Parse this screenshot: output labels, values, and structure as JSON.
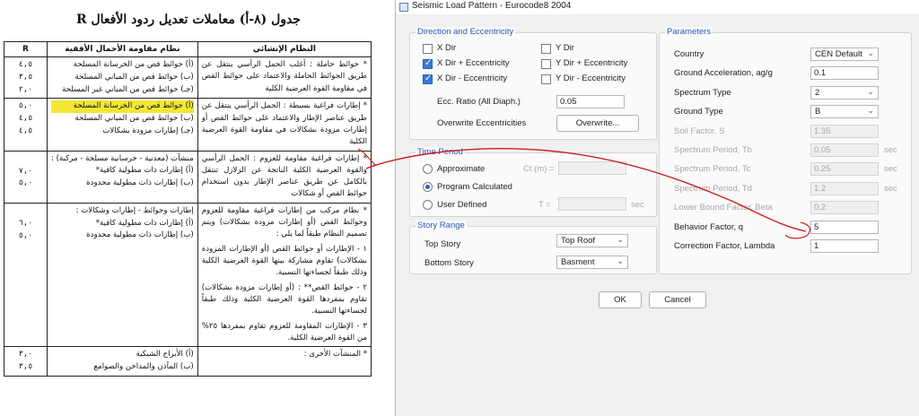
{
  "doc": {
    "title": "جدول (٨-أ) معاملات تعديل ردود الأفعال  R",
    "headers": {
      "r": "R",
      "resist": "نظام مقاومة الأحمال الأفقية",
      "structural": "النظام الإنشائي"
    },
    "rows": [
      {
        "r": [
          "٤,٥",
          "٣,٥",
          "٢,٠"
        ],
        "resist": [
          "(أ) حوائط قص من الخرسانة المسلحة",
          "(ب) حوائط قص من المباني المسلحة",
          "(جـ) حوائط قص من المباني غير المسلحة"
        ],
        "structural": "* حوائط حاملة : أغلب الحمل الرأسي ينتقل عن طريق الحوائط الحاملة والاعتماد على حوائط القص في مقاومة القوة العرضية الكلية"
      },
      {
        "r": [
          "٥,٠",
          "٤,٥",
          "٤,٥"
        ],
        "resist": [
          "(أ) حوائط قص من الخرسانة المسلحة",
          "(ب) حوائط قص من المباني المسلحة",
          "(جـ) إطارات مزودة بشكالات"
        ],
        "structural": "* إطارات فراغية بسيطة : الحمل الرأسي ينتقل عن طريق عناصر الإطار والاعتماد على حوائط القص أو إطارات مزودة بشكالات في مقاومة القوة العرضية الكلية"
      },
      {
        "r": [
          "٧,٠",
          "٥,٠"
        ],
        "resist": [
          "منشآت (معدنية - خرسانية مسلحة - مركبة) :",
          "(أ) إطارات ذات مطولية كافية*",
          "(ب) إطارات ذات مطولية محدودة"
        ],
        "structural": "* إطارات فراغية مقاومة للعزوم : الحمل الرأسي والقوة العرضية الكلية الناتجة عن الزلازل تنتقل بالكامل عن طريق عناصر الإطار بدون استخدام حوائط القص أو شكالات"
      },
      {
        "r": [
          "٦,٠",
          "٥,٠"
        ],
        "resist": [
          "إطارات وحوائط - إطارات وشكالات :",
          "(أ) إطارات ذات مطولية كافية*",
          "(ب) إطارات ذات مطولية محدودة"
        ],
        "structural": "* نظام مركب من إطارات فراغية مقاومة للعزوم وحوائط القص (أو إطارات مزودة بشكالات) ويتم تصميم النظام طبقاً لما يلي :",
        "structural_items": [
          "١ - الإطارات أو حوائط القص (أو الإطارات المزودة بشكالات) تقاوم مشاركة بينها القوة العرضية الكلية وذلك طبقاً لجساءتها النسبية.",
          "٢ - حوائط القص** : (أو إطارات مزودة بشكالات) تقاوم بمفردها القوة العرضية الكلية وذلك طبقاً لجساءتها النسبية.",
          "٣ - الإطارات المقاومة للعزوم تقاوم بمفردها ٢٥% من القوة العرضية الكلية."
        ]
      },
      {
        "r": [
          "٣,٠",
          "٣,٥"
        ],
        "resist": [
          "(أ) الأبراج الشبكية",
          "(ب) المآذن والمداخن والصوامع"
        ],
        "structural": "* المنشآت الأخرى :"
      }
    ]
  },
  "dialog": {
    "title": "Seismic Load Pattern - Eurocode8 2004",
    "direction_group": {
      "label": "Direction and Eccentricity",
      "options": [
        {
          "label": "X Dir",
          "checked": false
        },
        {
          "label": "Y Dir",
          "checked": false
        },
        {
          "label": "X Dir + Eccentricity",
          "checked": true
        },
        {
          "label": "Y Dir + Eccentricity",
          "checked": false
        },
        {
          "label": "X Dir - Eccentricity",
          "checked": true
        },
        {
          "label": "Y Dir - Eccentricity",
          "checked": false
        }
      ],
      "ecc_label": "Ecc. Ratio (All Diaph.)",
      "ecc_value": "0.05",
      "overwrite_label": "Overwrite Eccentricities",
      "overwrite_button": "Overwrite..."
    },
    "time_period_group": {
      "label": "Time Period",
      "options": [
        {
          "label": "Approximate",
          "selected": false
        },
        {
          "label": "Program Calculated",
          "selected": true
        },
        {
          "label": "User Defined",
          "selected": false
        }
      ],
      "ct_label": "Ct (m) =",
      "t_label": "T =",
      "t_unit": "sec"
    },
    "story_range_group": {
      "label": "Story Range",
      "top_label": "Top Story",
      "top_value": "Top Roof",
      "bottom_label": "Bottom Story",
      "bottom_value": "Basment"
    },
    "parameters_group": {
      "label": "Parameters",
      "rows": [
        {
          "label": "Country",
          "value": "CEN Default",
          "kind": "dropdown",
          "disabled": false,
          "unit": ""
        },
        {
          "label": "Ground Acceleration, ag/g",
          "value": "0.1",
          "kind": "text",
          "disabled": false,
          "unit": ""
        },
        {
          "label": "Spectrum Type",
          "value": "2",
          "kind": "dropdown",
          "disabled": false,
          "unit": ""
        },
        {
          "label": "Ground Type",
          "value": "B",
          "kind": "dropdown",
          "disabled": false,
          "unit": ""
        },
        {
          "label": "Soil Factor, S",
          "value": "1.35",
          "kind": "text",
          "disabled": true,
          "unit": ""
        },
        {
          "label": "Spectrum Period, Tb",
          "value": "0.05",
          "kind": "text",
          "disabled": true,
          "unit": "sec"
        },
        {
          "label": "Spectrum Period, Tc",
          "value": "0.25",
          "kind": "text",
          "disabled": true,
          "unit": "sec"
        },
        {
          "label": "Spectrum Period, Td",
          "value": "1.2",
          "kind": "text",
          "disabled": true,
          "unit": "sec"
        },
        {
          "label": "Lower Bound Factor, Beta",
          "value": "0.2",
          "kind": "text",
          "disabled": true,
          "unit": ""
        },
        {
          "label": "Behavior Factor, q",
          "value": "5",
          "kind": "text",
          "disabled": false,
          "unit": ""
        },
        {
          "label": "Correction Factor, Lambda",
          "value": "1",
          "kind": "text",
          "disabled": false,
          "unit": ""
        }
      ]
    },
    "ok_button": "OK",
    "cancel_button": "Cancel"
  },
  "colors": {
    "accent": "#2d58b5",
    "annotation": "#cc1f1f",
    "highlight": "#f3e634"
  }
}
